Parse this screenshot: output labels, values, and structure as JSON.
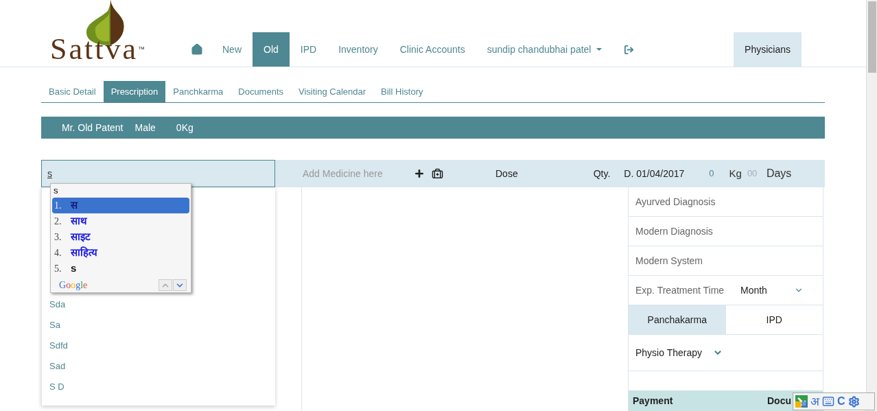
{
  "logo": {
    "brand": "Sattva",
    "mark": "™"
  },
  "nav": [
    {
      "kind": "home",
      "selected": false
    },
    {
      "kind": "link",
      "label": "New",
      "selected": false
    },
    {
      "kind": "link",
      "label": "Old",
      "selected": true
    },
    {
      "kind": "link",
      "label": "IPD",
      "selected": false
    },
    {
      "kind": "link",
      "label": "Inventory",
      "selected": false
    },
    {
      "kind": "link",
      "label": "Clinic Accounts",
      "selected": false
    },
    {
      "kind": "dropdown",
      "label": "sundip chandubhai patel",
      "selected": false
    },
    {
      "kind": "logout",
      "selected": false
    }
  ],
  "nav_right": {
    "label": "Physicians"
  },
  "subtabs": [
    {
      "label": "Basic Detail",
      "selected": false
    },
    {
      "label": "Prescription",
      "selected": true
    },
    {
      "label": "Panchkarma",
      "selected": false
    },
    {
      "label": "Documents",
      "selected": false
    },
    {
      "label": "Visiting Calendar",
      "selected": false
    },
    {
      "label": "Bill History",
      "selected": false
    }
  ],
  "patient": {
    "name": "Mr. Old Patent",
    "gender": "Male",
    "weight": "0Kg"
  },
  "medicine_row": {
    "search_value": "s",
    "medicine_placeholder": "Add Medicine here",
    "dose": "Dose",
    "qty": "Qty.",
    "date": "D. 01/04/2017",
    "weight_value": "0",
    "weight_unit": "Kg",
    "days_placeholder": "00",
    "days_unit": "Days"
  },
  "suggestions": [
    "Sda",
    "Sa",
    "Sdfd",
    "Sad",
    "S D"
  ],
  "ime_popup": {
    "input": "s",
    "brand": "Google",
    "candidates": [
      {
        "number": "1.",
        "text": "स",
        "selected": true
      },
      {
        "number": "2.",
        "text": "साथ",
        "selected": false
      },
      {
        "number": "3.",
        "text": "साइट",
        "selected": false
      },
      {
        "number": "4.",
        "text": "साहित्य",
        "selected": false
      },
      {
        "number": "5.",
        "text": "s",
        "selected": false
      }
    ]
  },
  "right_panel": {
    "fields": [
      "Ayurved Diagnosis",
      "Modern Diagnosis",
      "Modern System"
    ],
    "treatment": {
      "label": "Exp. Treatment Time",
      "value": "Month"
    },
    "toggle": [
      {
        "label": "Panchakarma",
        "selected": true
      },
      {
        "label": "IPD",
        "selected": false
      }
    ],
    "physio": "Physio Therapy",
    "table_header": [
      "Payment",
      "Docu"
    ]
  },
  "input_tools": {
    "language_glyph": "अ",
    "letter": "C"
  }
}
